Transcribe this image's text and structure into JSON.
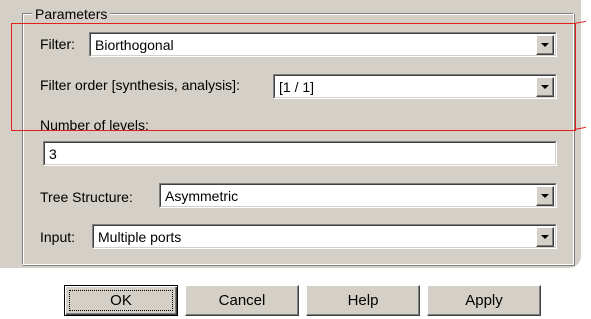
{
  "parameters": {
    "group_title": "Parameters",
    "filter": {
      "label": "Filter:",
      "value": "Biorthogonal"
    },
    "filter_order": {
      "label": "Filter order [synthesis, analysis]:",
      "value": "[1 / 1]"
    },
    "levels": {
      "label": "Number of levels:",
      "value": "3"
    },
    "tree_structure": {
      "label": "Tree Structure:",
      "value": "Asymmetric"
    },
    "input": {
      "label": "Input:",
      "value": "Multiple ports"
    }
  },
  "buttons": {
    "ok": "OK",
    "cancel": "Cancel",
    "help": "Help",
    "apply": "Apply"
  },
  "icons": {
    "dropdown": "chevron-down-icon"
  },
  "colors": {
    "dialog_background": "#d4d0c8",
    "highlight_annotation": "#e0201f"
  }
}
